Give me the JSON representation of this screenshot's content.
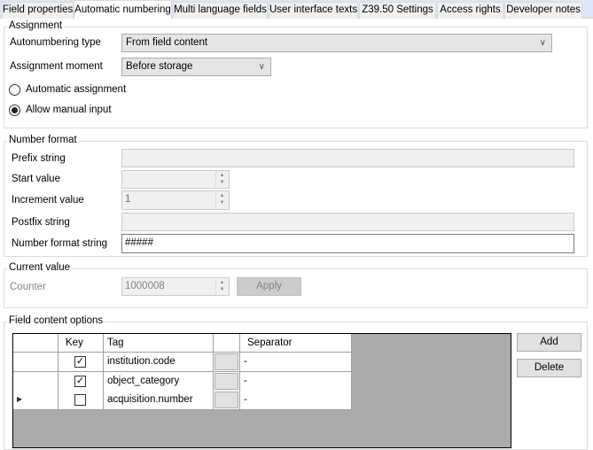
{
  "tabs": [
    {
      "label": "Field properties"
    },
    {
      "label": "Automatic numbering",
      "selected": true
    },
    {
      "label": "Multi language fields"
    },
    {
      "label": "User interface texts"
    },
    {
      "label": "Z39.50 Settings"
    },
    {
      "label": "Access rights"
    },
    {
      "label": "Developer notes"
    }
  ],
  "assignment": {
    "title": "Assignment",
    "type_label": "Autonumbering type",
    "type_value": "From field content",
    "moment_label": "Assignment moment",
    "moment_value": "Before storage",
    "radio_auto": "Automatic assignment",
    "radio_manual": "Allow manual input",
    "selected": "manual"
  },
  "number_format": {
    "title": "Number format",
    "prefix_label": "Prefix string",
    "prefix_value": "",
    "start_label": "Start value",
    "start_value": "",
    "increment_label": "Increment value",
    "increment_value": "1",
    "postfix_label": "Postfix string",
    "postfix_value": "",
    "format_label": "Number format string",
    "format_value": "#####"
  },
  "current_value": {
    "title": "Current value",
    "counter_label": "Counter",
    "counter_value": "1000008",
    "apply_label": "Apply"
  },
  "field_content": {
    "title": "Field content options",
    "columns": {
      "key": "Key",
      "tag": "Tag",
      "separator": "Separator"
    },
    "rows": [
      {
        "key": true,
        "tag": "institution.code",
        "separator": "-"
      },
      {
        "key": true,
        "tag": "object_category",
        "separator": "-"
      },
      {
        "key": false,
        "tag": "acquisition.number",
        "separator": "-",
        "current": true
      }
    ],
    "add_label": "Add",
    "delete_label": "Delete"
  }
}
